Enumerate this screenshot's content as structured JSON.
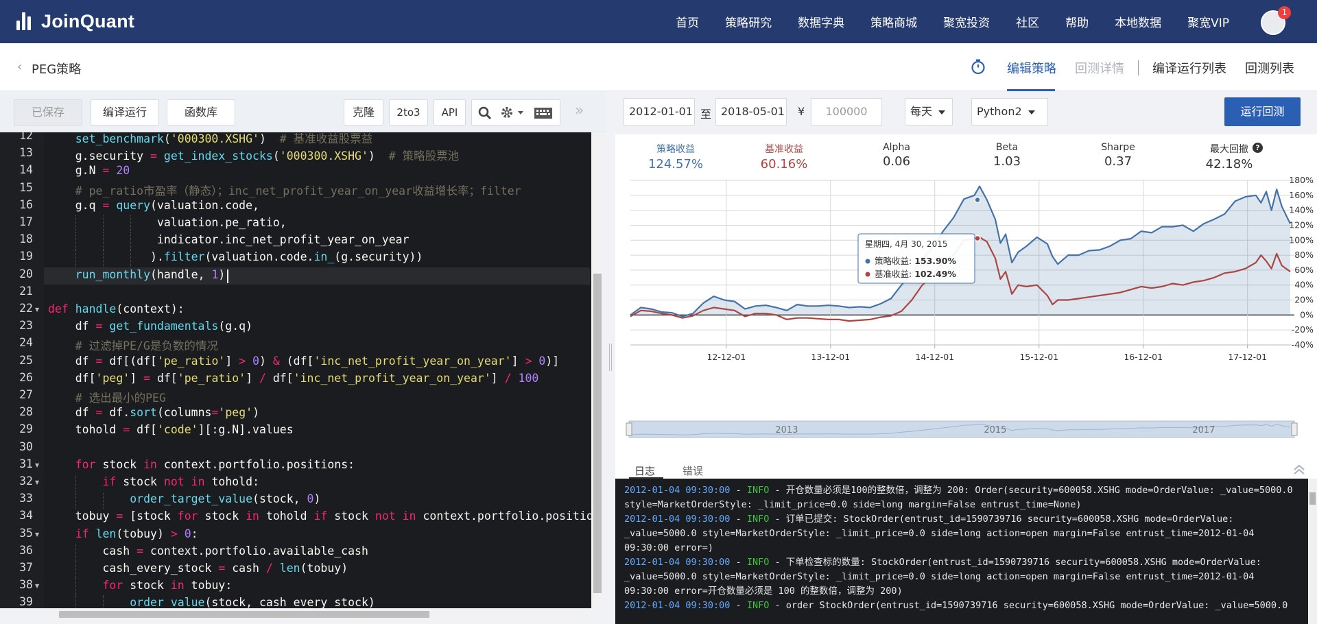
{
  "nav": {
    "logo_text": "JoinQuant",
    "items": [
      "首页",
      "策略研究",
      "数据字典",
      "策略商城",
      "聚宽投资",
      "社区",
      "帮助",
      "本地数据",
      "聚宽VIP"
    ],
    "notification_count": "1"
  },
  "subheader": {
    "back_icon": "‹",
    "strategy_name": "PEG策略",
    "tabs": {
      "edit": "编辑策略",
      "backtest_detail": "回测详情",
      "compile_list": "编译运行列表",
      "backtest_list": "回测列表"
    }
  },
  "editor_toolbar": {
    "saved": "已保存",
    "compile_run": "编译运行",
    "func_lib": "函数库",
    "clone": "克隆",
    "to3": "2to3",
    "api": "API",
    "forward": "»"
  },
  "code": {
    "start_line": 12,
    "lines": [
      "    set_benchmark('000300.XSHG')  # 基准收益股票益",
      "    g.security = get_index_stocks('000300.XSHG')  # 策略股票池",
      "    g.N = 20",
      "    # pe_ratio市盈率（静态）；inc_net_profit_year_on_year收益增长率；filter",
      "    g.q = query(valuation.code,",
      "                valuation.pe_ratio,",
      "                indicator.inc_net_profit_year_on_year",
      "               ).filter(valuation.code.in_(g.security))",
      "    run_monthly(handle, 1)",
      "",
      "def handle(context):",
      "    df = get_fundamentals(g.q)",
      "    # 过滤掉PE/G是负数的情况",
      "    df = df[(df['pe_ratio'] > 0) & (df['inc_net_profit_year_on_year'] > 0)]",
      "    df['peg'] = df['pe_ratio'] / df['inc_net_profit_year_on_year'] / 100",
      "    # 选出最小的PEG",
      "    df = df.sort(columns='peg')",
      "    tohold = df['code'][:g.N].values",
      "",
      "    for stock in context.portfolio.positions:",
      "        if stock not in tohold:",
      "            order_target_value(stock, 0)",
      "    tobuy = [stock for stock in tohold if stock not in context.portfolio.positions]",
      "    if len(tobuy) > 0:",
      "        cash = context.portfolio.available_cash",
      "        cash_every_stock = cash / len(tobuy)",
      "        for stock in tobuy:",
      "            order_value(stock, cash_every_stock)"
    ]
  },
  "backtest": {
    "start_date": "2012-01-01",
    "to_label": "至",
    "end_date": "2018-05-01",
    "currency": "¥",
    "capital": "100000",
    "frequency": "每天",
    "python": "Python2",
    "run_button": "运行回测"
  },
  "stats": [
    {
      "label": "策略收益",
      "value": "124.57%",
      "color": "#4572a7"
    },
    {
      "label": "基准收益",
      "value": "60.16%",
      "color": "#aa4643"
    },
    {
      "label": "Alpha",
      "value": "0.06",
      "color": "#333333"
    },
    {
      "label": "Beta",
      "value": "1.03",
      "color": "#333333"
    },
    {
      "label": "Sharpe",
      "value": "0.37",
      "color": "#333333"
    },
    {
      "label": "最大回撤",
      "value": "42.18%",
      "color": "#333333"
    }
  ],
  "chart_data": {
    "type": "line",
    "x_ticks": [
      "12-12-01",
      "13-12-01",
      "14-12-01",
      "15-12-01",
      "16-12-01",
      "17-12-01"
    ],
    "y_ticks": [
      "180%",
      "160%",
      "140%",
      "120%",
      "100%",
      "80%",
      "60%",
      "40%",
      "20%",
      "0%",
      "-20%",
      "-40%"
    ],
    "ylim": [
      -40,
      180
    ],
    "navigator_labels": [
      "2013",
      "2015",
      "2017"
    ],
    "tooltip": {
      "date": "星期四, 4月 30, 2015",
      "strategy_label": "策略收益:",
      "strategy_value": "153.90%",
      "benchmark_label": "基准收益:",
      "benchmark_value": "102.49%"
    },
    "series": [
      {
        "name": "策略收益",
        "color": "#4572a7",
        "x": [
          2012.0,
          2012.1,
          2012.2,
          2012.3,
          2012.4,
          2012.5,
          2012.6,
          2012.7,
          2012.8,
          2012.9,
          2013.0,
          2013.1,
          2013.2,
          2013.3,
          2013.4,
          2013.5,
          2013.6,
          2013.7,
          2013.8,
          2013.9,
          2014.0,
          2014.1,
          2014.2,
          2014.3,
          2014.4,
          2014.5,
          2014.6,
          2014.7,
          2014.8,
          2014.9,
          2015.0,
          2015.1,
          2015.2,
          2015.3,
          2015.35,
          2015.42,
          2015.5,
          2015.55,
          2015.6,
          2015.66,
          2015.72,
          2015.8,
          2015.9,
          2016.0,
          2016.05,
          2016.1,
          2016.2,
          2016.3,
          2016.4,
          2016.5,
          2016.6,
          2016.7,
          2016.8,
          2016.9,
          2017.0,
          2017.1,
          2017.2,
          2017.3,
          2017.4,
          2017.5,
          2017.6,
          2017.7,
          2017.8,
          2017.9,
          2018.0,
          2018.05,
          2018.1,
          2018.15,
          2018.2,
          2018.25,
          2018.33
        ],
        "values": [
          0,
          10,
          8,
          4,
          3,
          -2,
          2,
          16,
          25,
          20,
          18,
          8,
          12,
          13,
          10,
          6,
          14,
          12,
          12,
          13,
          12,
          10,
          11,
          10,
          15,
          22,
          40,
          55,
          75,
          90,
          112,
          130,
          155,
          160,
          172,
          154,
          128,
          96,
          108,
          70,
          84,
          92,
          104,
          95,
          78,
          68,
          80,
          80,
          86,
          87,
          92,
          100,
          102,
          112,
          110,
          118,
          118,
          120,
          112,
          122,
          128,
          135,
          152,
          158,
          160,
          150,
          165,
          140,
          168,
          145,
          122
        ]
      },
      {
        "name": "基准收益",
        "color": "#aa4643",
        "x": [
          2012.0,
          2012.1,
          2012.2,
          2012.3,
          2012.4,
          2012.5,
          2012.6,
          2012.7,
          2012.8,
          2012.9,
          2013.0,
          2013.1,
          2013.2,
          2013.3,
          2013.4,
          2013.5,
          2013.6,
          2013.7,
          2013.8,
          2013.9,
          2014.0,
          2014.1,
          2014.2,
          2014.3,
          2014.4,
          2014.5,
          2014.6,
          2014.7,
          2014.8,
          2014.9,
          2015.0,
          2015.1,
          2015.2,
          2015.3,
          2015.35,
          2015.42,
          2015.5,
          2015.55,
          2015.6,
          2015.66,
          2015.72,
          2015.8,
          2015.9,
          2016.0,
          2016.05,
          2016.1,
          2016.2,
          2016.3,
          2016.4,
          2016.5,
          2016.6,
          2016.7,
          2016.8,
          2016.9,
          2017.0,
          2017.1,
          2017.2,
          2017.3,
          2017.4,
          2017.5,
          2017.6,
          2017.7,
          2017.8,
          2017.9,
          2018.0,
          2018.05,
          2018.1,
          2018.15,
          2018.2,
          2018.25,
          2018.33
        ],
        "values": [
          -2,
          6,
          5,
          2,
          0,
          -4,
          -1,
          6,
          10,
          8,
          6,
          -2,
          2,
          2,
          0,
          -6,
          -4,
          -4,
          -5,
          -6,
          -6,
          -8,
          -7,
          -6,
          -3,
          -1,
          5,
          20,
          40,
          52,
          72,
          80,
          100,
          102,
          104,
          98,
          76,
          48,
          58,
          28,
          40,
          38,
          40,
          26,
          14,
          20,
          20,
          22,
          24,
          26,
          28,
          30,
          34,
          38,
          36,
          38,
          42,
          40,
          44,
          46,
          50,
          56,
          58,
          62,
          70,
          80,
          72,
          62,
          82,
          66,
          58
        ]
      }
    ]
  },
  "log": {
    "tabs": [
      "日志",
      "错误"
    ],
    "lines": [
      {
        "ts": "2012-01-04 09:30:00",
        "level": "INFO",
        "msg": "开仓数量必须是100的整数倍，调整为 200: Order(security=600058.XSHG mode=OrderValue: _value=5000.0 style=MarketOrderStyle: _limit_price=0.0 side=long margin=False entrust_time=None)"
      },
      {
        "ts": "2012-01-04 09:30:00",
        "level": "INFO",
        "msg": "订单已提交: StockOrder(entrust_id=1590739716 security=600058.XSHG mode=OrderValue: _value=5000.0 style=MarketOrderStyle: _limit_price=0.0 side=long action=open margin=False entrust_time=2012-01-04 09:30:00 error=)"
      },
      {
        "ts": "2012-01-04 09:30:00",
        "level": "INFO",
        "msg": "下单检查标的数量: StockOrder(entrust_id=1590739716 security=600058.XSHG mode=OrderValue: _value=5000.0 style=MarketOrderStyle: _limit_price=0.0 side=long action=open margin=False entrust_time=2012-01-04 09:30:00 error=开仓数量必须是 100 的整数倍，调整为 200)"
      },
      {
        "ts": "2012-01-04 09:30:00",
        "level": "INFO",
        "msg": "order StockOrder(entrust_id=1590739716 security=600058.XSHG mode=OrderValue: _value=5000.0"
      }
    ]
  }
}
